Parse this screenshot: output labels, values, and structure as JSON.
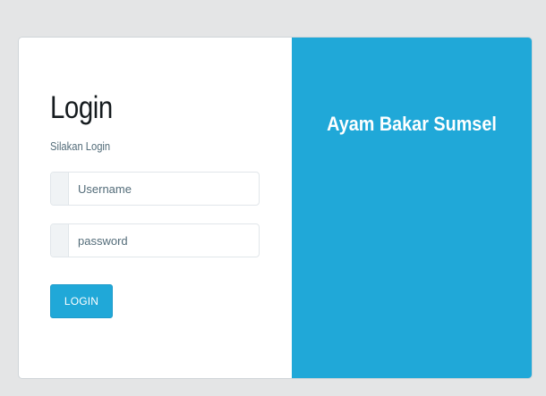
{
  "login": {
    "title": "Login",
    "subtitle": "Silakan Login",
    "username_placeholder": "Username",
    "username_value": "",
    "password_placeholder": "password",
    "password_value": "",
    "button_label": "LOGIN"
  },
  "brand": {
    "title": "Ayam Bakar Sumsel"
  },
  "colors": {
    "background": "#e4e5e6",
    "accent": "#20a8d8",
    "card": "#ffffff",
    "input_addon": "#f0f3f5",
    "text_dark": "#151b1e",
    "text_muted": "#536c79"
  }
}
